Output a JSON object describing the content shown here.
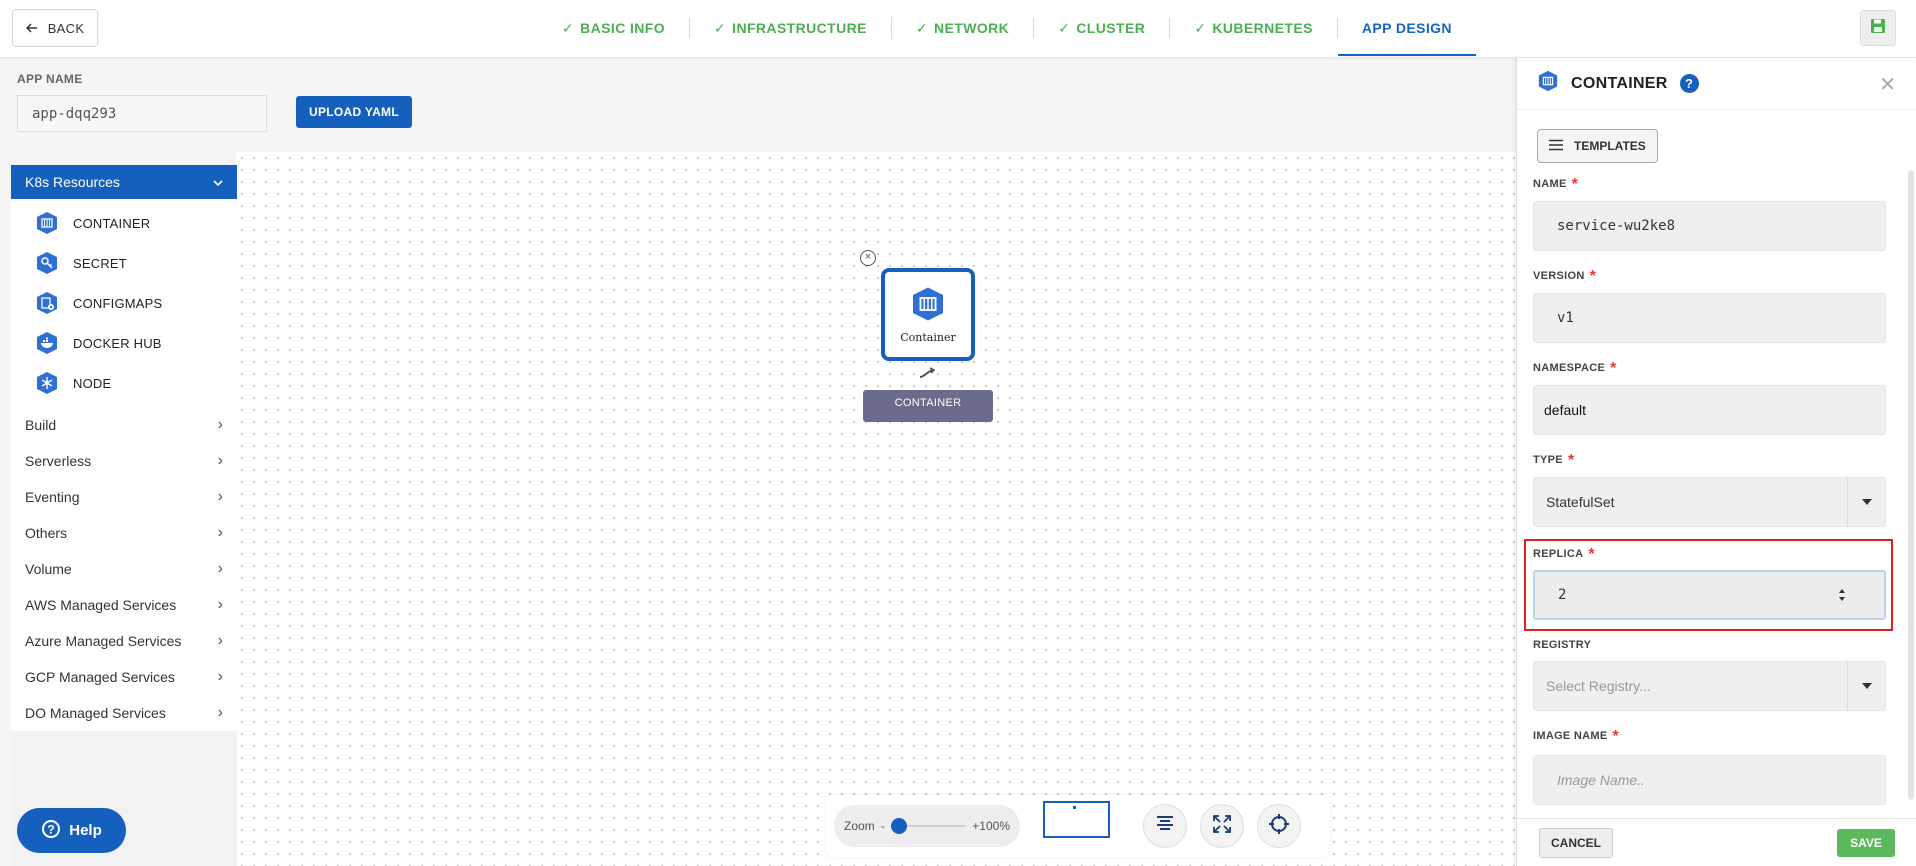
{
  "topbar": {
    "back_label": "BACK",
    "steps": [
      {
        "label": "BASIC INFO",
        "done": true
      },
      {
        "label": "INFRASTRUCTURE",
        "done": true
      },
      {
        "label": "NETWORK",
        "done": true
      },
      {
        "label": "CLUSTER",
        "done": true
      },
      {
        "label": "KUBERNETES",
        "done": true
      },
      {
        "label": "APP DESIGN",
        "done": false
      }
    ]
  },
  "app": {
    "name_label": "APP NAME",
    "name_value": "app-dqq293",
    "upload_label": "UPLOAD YAML"
  },
  "sidebar": {
    "k8s_header": "K8s Resources",
    "k8s_items": [
      {
        "label": "CONTAINER",
        "icon": "container-icon"
      },
      {
        "label": "SECRET",
        "icon": "key-icon"
      },
      {
        "label": "CONFIGMAPS",
        "icon": "configmap-icon"
      },
      {
        "label": "DOCKER HUB",
        "icon": "docker-icon"
      },
      {
        "label": "NODE",
        "icon": "node-icon"
      }
    ],
    "groups": [
      "Build",
      "Serverless",
      "Eventing",
      "Others",
      "Volume",
      "AWS Managed Services",
      "Azure Managed Services",
      "GCP Managed Services",
      "DO Managed Services"
    ]
  },
  "canvas": {
    "node_label": "Container",
    "node_tag": "CONTAINER",
    "help_label": "Help",
    "zoom_label": "Zoom",
    "zoom_minus": "-",
    "zoom_value": "+100%"
  },
  "panel": {
    "title": "CONTAINER",
    "help_glyph": "?",
    "templates_label": "TEMPLATES",
    "fields": {
      "name": {
        "label": "NAME",
        "value": "service-wu2ke8"
      },
      "version": {
        "label": "VERSION",
        "value": "v1"
      },
      "namespace": {
        "label": "NAMESPACE",
        "value": "default"
      },
      "type": {
        "label": "TYPE",
        "value": "StatefulSet"
      },
      "replica": {
        "label": "REPLICA",
        "value": "2"
      },
      "registry": {
        "label": "REGISTRY",
        "placeholder": "Select Registry..."
      },
      "image_name": {
        "label": "IMAGE NAME",
        "placeholder": "Image Name.."
      }
    },
    "required_mark": "*",
    "cancel_label": "CANCEL",
    "save_label": "SAVE"
  },
  "colors": {
    "primary": "#1560bd",
    "success": "#4caf50",
    "highlight": "#e02020"
  }
}
